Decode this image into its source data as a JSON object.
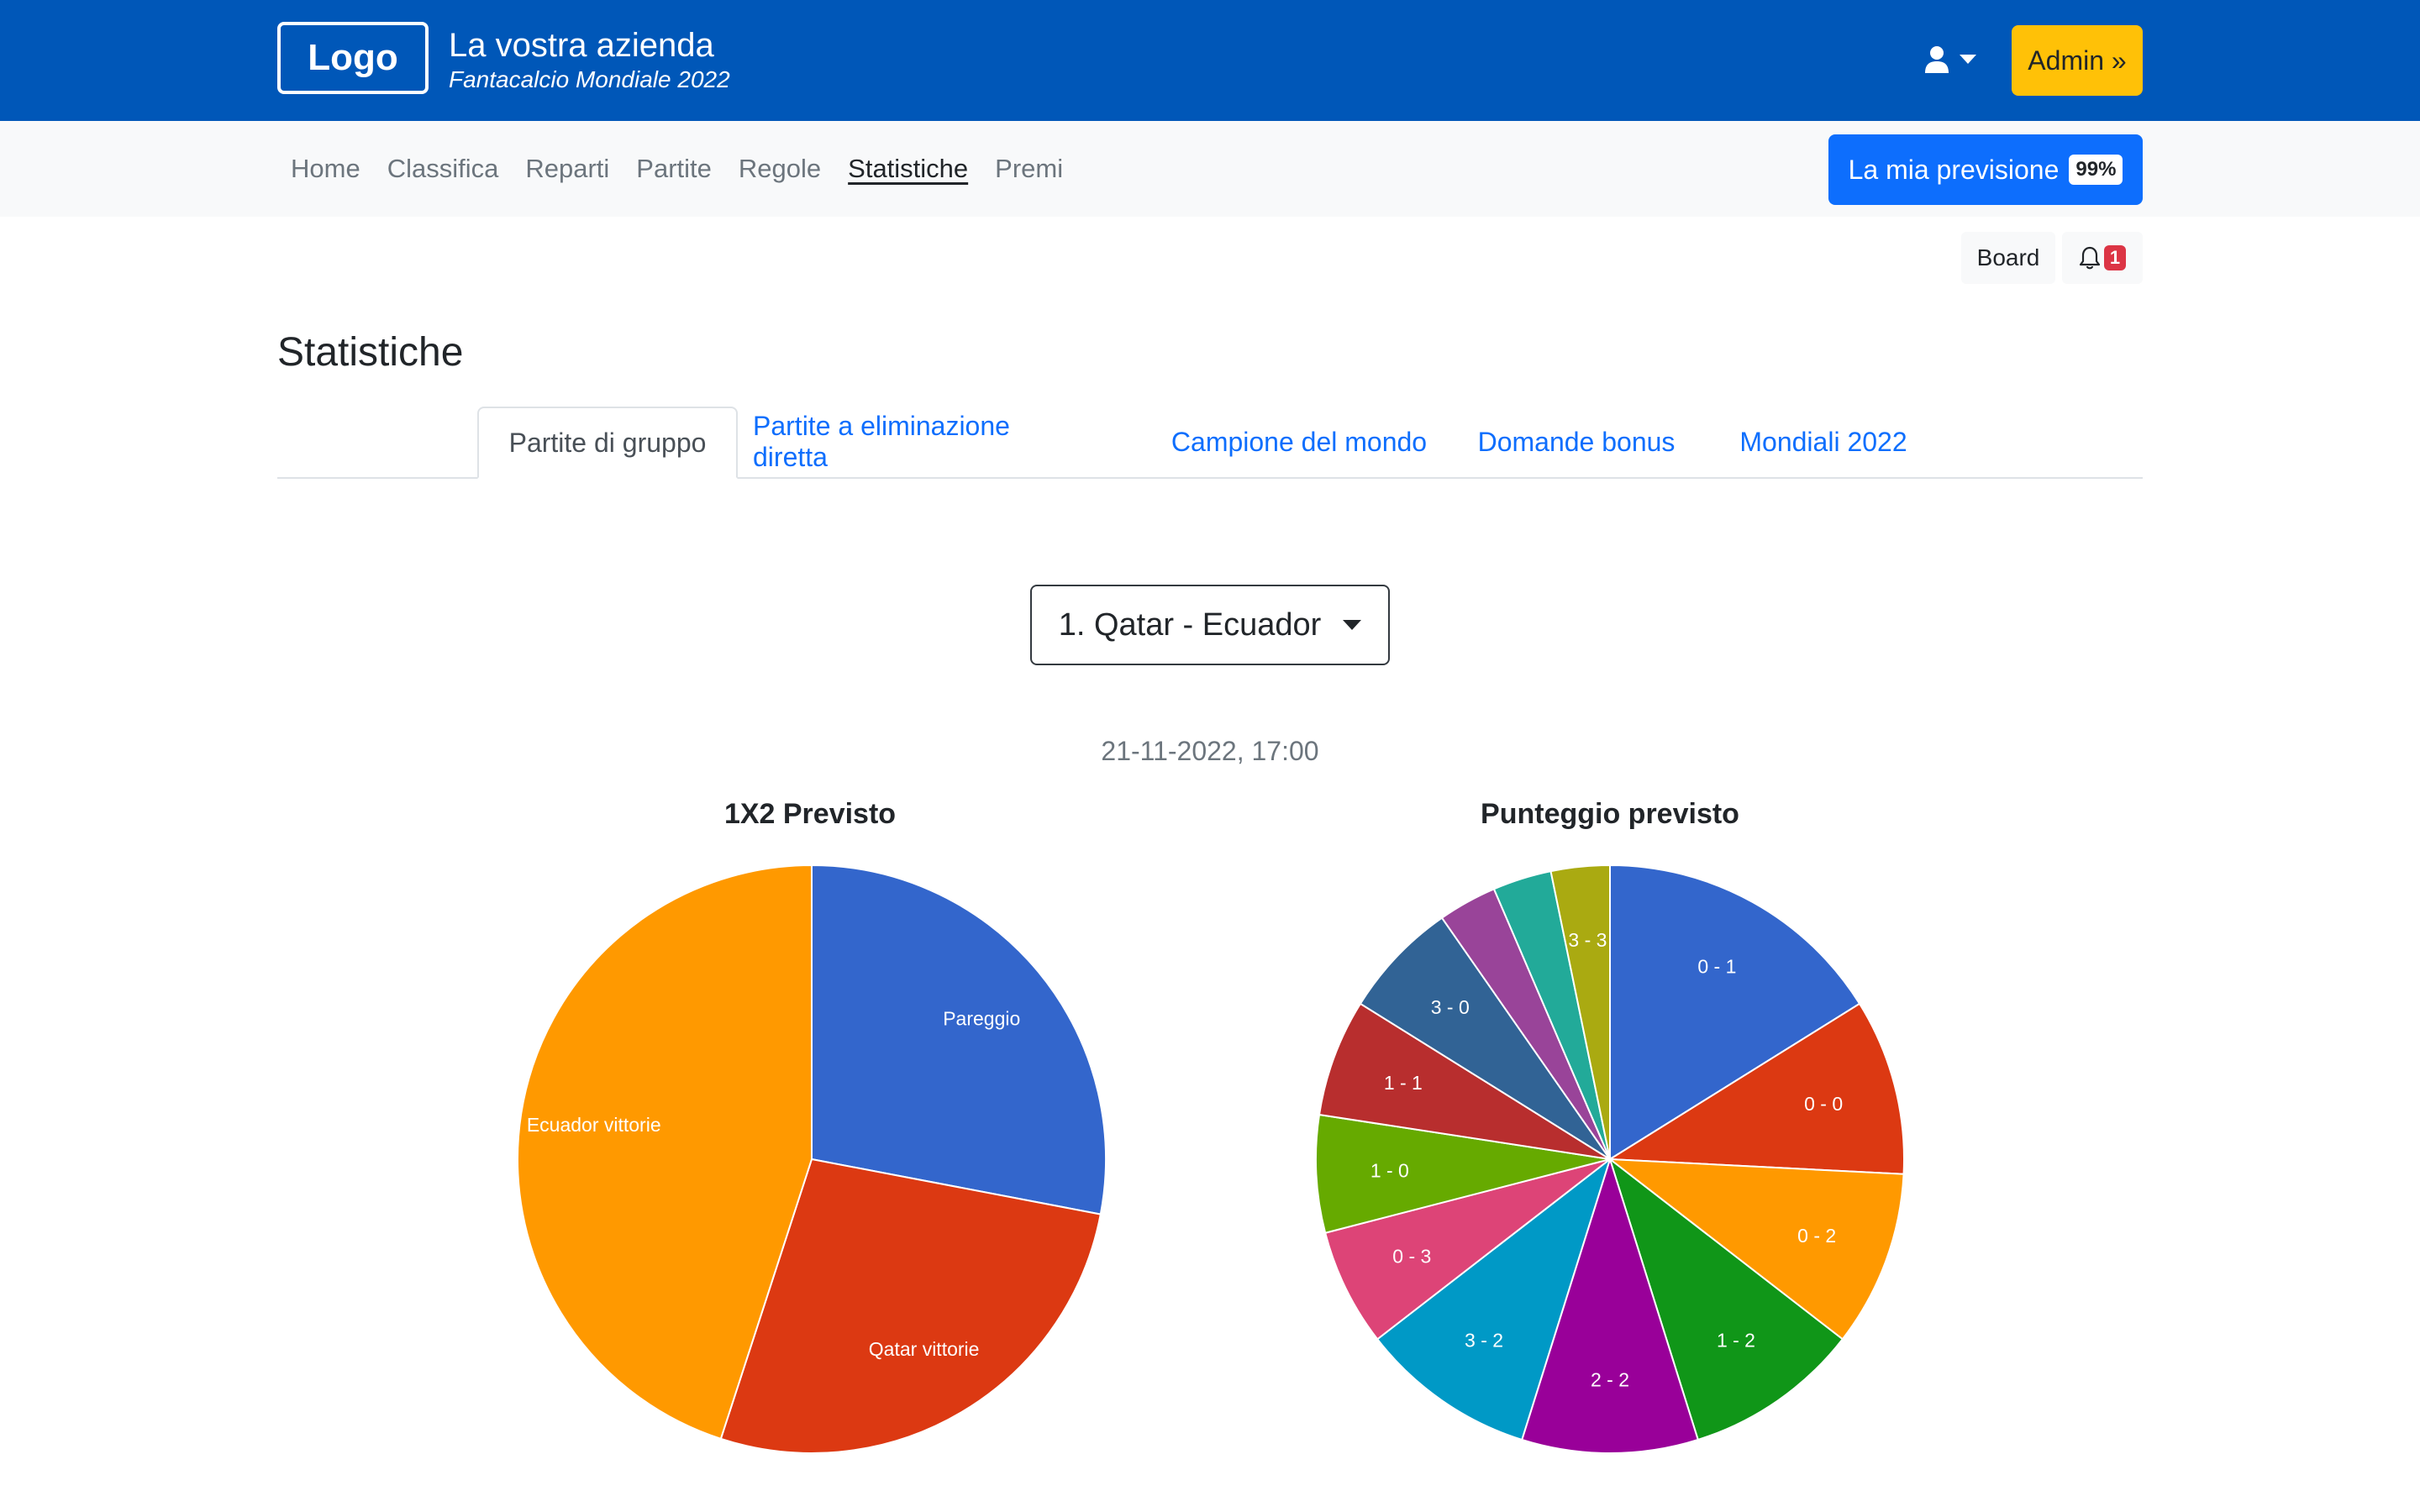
{
  "header": {
    "logo": "Logo",
    "company_name": "La vostra azienda",
    "subtitle": "Fantacalcio Mondiale 2022",
    "admin_label": "Admin »",
    "user_icon": "user-icon"
  },
  "nav": {
    "items": [
      {
        "label": "Home",
        "active": false
      },
      {
        "label": "Classifica",
        "active": false
      },
      {
        "label": "Reparti",
        "active": false
      },
      {
        "label": "Partite",
        "active": false
      },
      {
        "label": "Regole",
        "active": false
      },
      {
        "label": "Statistiche",
        "active": true
      },
      {
        "label": "Premi",
        "active": false
      }
    ],
    "prevision_label": "La mia previsione",
    "prevision_badge": "99%"
  },
  "toolbar": {
    "board_label": "Board",
    "notification_count": "1"
  },
  "page": {
    "title": "Statistiche",
    "tabs": [
      {
        "label": "Partite di gruppo",
        "active": true
      },
      {
        "label": "Partite a eliminazione diretta",
        "active": false
      },
      {
        "label": "Campione del mondo",
        "active": false
      },
      {
        "label": "Domande bonus",
        "active": false
      },
      {
        "label": "Mondiali 2022",
        "active": false
      }
    ],
    "match_select": "1. Qatar - Ecuador",
    "match_date": "21-11-2022, 17:00"
  },
  "colors": {
    "header": "#0057b8",
    "admin": "#ffc107",
    "primary": "#0d6efd"
  },
  "chart_data": [
    {
      "type": "pie",
      "title": "1X2 Previsto",
      "slices": [
        {
          "label": "Pareggio",
          "value": 28,
          "color": "#3366cc"
        },
        {
          "label": "Qatar vittorie",
          "value": 27,
          "color": "#dc3912"
        },
        {
          "label": "Ecuador vittorie",
          "value": 45,
          "color": "#ff9900"
        }
      ]
    },
    {
      "type": "pie",
      "title": "Punteggio previsto",
      "slices": [
        {
          "label": "0 - 1",
          "value": 15,
          "color": "#3366cc"
        },
        {
          "label": "0 - 0",
          "value": 9,
          "color": "#dc3912"
        },
        {
          "label": "0 - 2",
          "value": 9,
          "color": "#ff9900"
        },
        {
          "label": "1 - 2",
          "value": 9,
          "color": "#109618"
        },
        {
          "label": "2 - 2",
          "value": 9,
          "color": "#990099"
        },
        {
          "label": "3 - 2",
          "value": 9,
          "color": "#0099c6"
        },
        {
          "label": "0 - 3",
          "value": 6,
          "color": "#dd4477"
        },
        {
          "label": "1 - 0",
          "value": 6,
          "color": "#66aa00"
        },
        {
          "label": "1 - 1",
          "value": 6,
          "color": "#b82e2e"
        },
        {
          "label": "3 - 0",
          "value": 6,
          "color": "#316395"
        },
        {
          "label": "",
          "value": 3,
          "color": "#994499"
        },
        {
          "label": "",
          "value": 3,
          "color": "#22aa99"
        },
        {
          "label": "3 - 3",
          "value": 3,
          "color": "#aaaa11"
        }
      ]
    }
  ]
}
